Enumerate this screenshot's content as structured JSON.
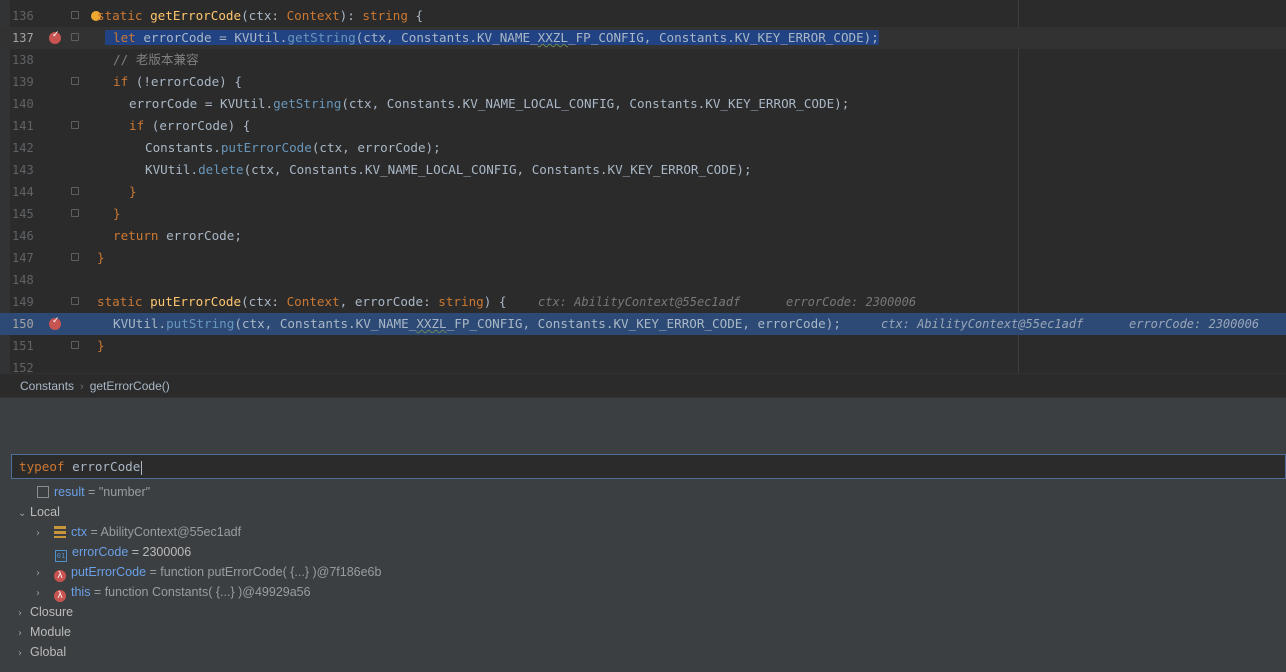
{
  "editor": {
    "lines": [
      {
        "num": "136"
      },
      {
        "num": "137"
      },
      {
        "num": "138"
      },
      {
        "num": "139"
      },
      {
        "num": "140"
      },
      {
        "num": "141"
      },
      {
        "num": "142"
      },
      {
        "num": "143"
      },
      {
        "num": "144"
      },
      {
        "num": "145"
      },
      {
        "num": "146"
      },
      {
        "num": "147"
      },
      {
        "num": "148"
      },
      {
        "num": "149"
      },
      {
        "num": "150"
      },
      {
        "num": "151"
      },
      {
        "num": "152"
      }
    ],
    "code": {
      "l136": {
        "kw": "static",
        "fn": "getErrorCode",
        "p1": "(ctx: ",
        "ty": "Context",
        "p2": "): ",
        "ret": "string",
        "p3": " {"
      },
      "l137": {
        "kw": "let",
        "p1": " errorCode = KVUtil.",
        "mt": "getString",
        "p2": "(ctx, Constants.KV_NAME_",
        "wav": "XXZL",
        "p3": "_FP_CONFIG, Constants.KV_KEY_ERROR_CODE);"
      },
      "l138": {
        "cm": "// 老版本兼容"
      },
      "l139": {
        "kw": "if",
        "p1": " (!errorCode) {"
      },
      "l140": {
        "p1": "errorCode = KVUtil.",
        "mt": "getString",
        "p2": "(ctx, Constants.KV_NAME_LOCAL_CONFIG, Constants.KV_KEY_ERROR_CODE);"
      },
      "l141": {
        "kw": "if",
        "p1": " (errorCode) {"
      },
      "l142": {
        "p1": "Constants.",
        "mt": "putErrorCode",
        "p2": "(ctx, errorCode);"
      },
      "l143": {
        "p1": "KVUtil.",
        "mt": "delete",
        "p2": "(ctx, Constants.KV_NAME_LOCAL_CONFIG, Constants.KV_KEY_ERROR_CODE);"
      },
      "l144": {
        "p1": "}"
      },
      "l145": {
        "p1": "}"
      },
      "l146": {
        "kw": "return",
        "p1": " errorCode;"
      },
      "l147": {
        "p1": "}"
      },
      "l149": {
        "kw": "static",
        "fn": "putErrorCode",
        "p1": "(ctx: ",
        "ty": "Context",
        "p2": ", errorCode: ",
        "ret": "string",
        "p3": ") {"
      },
      "l149_hint1": "ctx: AbilityContext@55ec1adf",
      "l149_hint2": "errorCode: 2300006",
      "l150": {
        "p1": "KVUtil.",
        "mt": "putString",
        "p2": "(ctx, Constants.KV_NAME_",
        "wav": "XXZL",
        "p3": "_FP_CONFIG, Constants.KV_KEY_ERROR_CODE, errorCode);"
      },
      "l150_hint1": "ctx: AbilityContext@55ec1adf",
      "l150_hint2": "errorCode: 2300006",
      "l151": {
        "p1": "}"
      }
    }
  },
  "breadcrumbs": {
    "item1": "Constants",
    "item2": "getErrorCode()"
  },
  "evaluate": {
    "keyword": "typeof",
    "expression": " errorCode"
  },
  "variables": {
    "result": {
      "name": "result",
      "eq": " = ",
      "value": "\"number\""
    },
    "local_label": "Local",
    "ctx": {
      "name": "ctx",
      "eq": " = ",
      "value": "AbilityContext@55ec1adf"
    },
    "errorCode": {
      "name": "errorCode",
      "eq": " = ",
      "value": "2300006"
    },
    "putErrorCode": {
      "name": "putErrorCode",
      "eq": " = ",
      "value": "function putErrorCode( {...} )@7f186e6b"
    },
    "this": {
      "name": "this",
      "eq": " = ",
      "value": "function Constants( {...} )@49929a56"
    },
    "closure_label": "Closure",
    "module_label": "Module",
    "global_label": "Global"
  },
  "icons": {
    "breakpoint": "breakpoint-icon",
    "bulb": "intention-bulb-icon",
    "fold": "fold-marker-icon",
    "calc": "calculator-icon",
    "object": "object-field-icon",
    "number": "number-field-icon",
    "function": "lambda-icon"
  },
  "colors": {
    "background": "#2b2b2b",
    "selection": "#214283",
    "execution_line": "#2d4a76",
    "breakpoint": "#c75450",
    "keyword": "#cc7832",
    "function": "#ffc66d",
    "method": "#6897bb",
    "variable_name": "#6aa0e8"
  }
}
